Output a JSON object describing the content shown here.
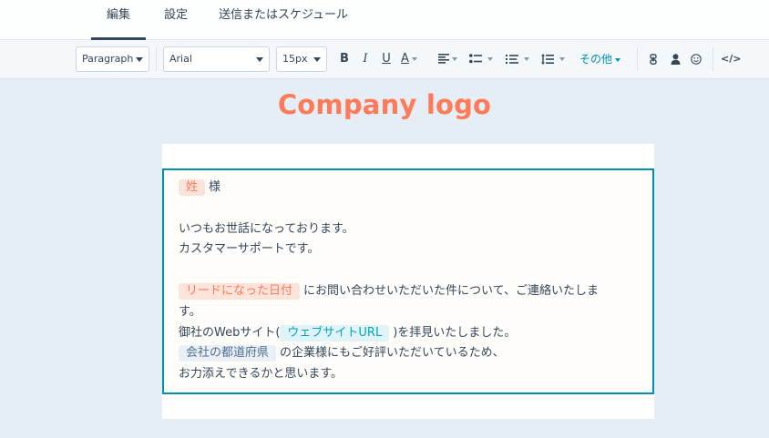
{
  "tabs": [
    {
      "label": "編集",
      "active": true
    },
    {
      "label": "設定",
      "active": false
    },
    {
      "label": "送信またはスケジュール",
      "active": false
    }
  ],
  "toolbar": {
    "paragraph": "Paragraph",
    "font": "Arial",
    "size": "15px",
    "bold": "B",
    "italic": "I",
    "underline": "U",
    "font_color": "A",
    "more": "その他",
    "source": "</>"
  },
  "logo_text": "Company logo",
  "editor": {
    "token_last_name": "姓",
    "honorific": "様",
    "p1_line1": "いつもお世話になっております。",
    "p1_line2": "カスタマーサポートです。",
    "token_lead_date": "リードになった日付",
    "p2_line1_after": "にお問い合わせいただいた件について、ご連絡いたしま",
    "p2_line2": "す。",
    "p2_line3_before": "御社のWebサイト(",
    "token_website": "ウェブサイトURL",
    "p2_line3_after": ")を拝見いたしました。",
    "token_prefecture": "会社の都道府県",
    "p2_line4_after": "の企業様にもご好評いただいているため、",
    "p2_line5": "お力添えできるかと思います。"
  },
  "colors": {
    "accent": "#0091ae",
    "logo": "#ff7a59",
    "token_orange_bg": "#fde4da",
    "token_blue_bg": "#e0f4f7"
  }
}
